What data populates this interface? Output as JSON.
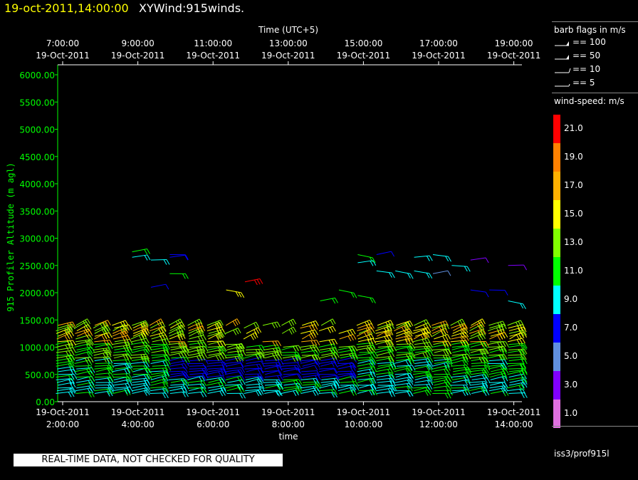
{
  "header": {
    "datetime": "19-oct-2011,14:00:00",
    "product": "XYWind:915winds."
  },
  "footer": {
    "quality_notice": "REAL-TIME DATA, NOT CHECKED FOR QUALITY"
  },
  "legend": {
    "barb_title": "barb flags in m/s",
    "barbs": [
      {
        "value": "== 100",
        "kind": "flag"
      },
      {
        "value": "== 50",
        "kind": "flag"
      },
      {
        "value": "== 10",
        "kind": "full"
      },
      {
        "value": "== 5",
        "kind": "half"
      }
    ],
    "speed_title": "wind-speed: m/s",
    "speed_bins": [
      {
        "label": "21.0",
        "color": "#ff0000"
      },
      {
        "label": "19.0",
        "color": "#ff8000"
      },
      {
        "label": "17.0",
        "color": "#ffb000"
      },
      {
        "label": "15.0",
        "color": "#ffff00"
      },
      {
        "label": "13.0",
        "color": "#80ff00"
      },
      {
        "label": "11.0",
        "color": "#00ff00"
      },
      {
        "label": "9.0",
        "color": "#00ffff"
      },
      {
        "label": "7.0",
        "color": "#0000ff"
      },
      {
        "label": "5.0",
        "color": "#6090e0"
      },
      {
        "label": "3.0",
        "color": "#8000ff"
      },
      {
        "label": "1.0",
        "color": "#e070e0"
      }
    ],
    "station": "iss3/prof915l"
  },
  "chart_data": {
    "type": "scatter",
    "subtype": "wind-barb time-height profile",
    "xlabel": "time",
    "x2label": "Time (UTC+5)",
    "ylabel": "915 Profiler Altitude (m agl)",
    "x_range_hours": [
      1.5,
      14.1
    ],
    "ylim": [
      0,
      6200
    ],
    "yticks": [
      "0.00",
      "500.00",
      "1000.00",
      "1500.00",
      "2000.00",
      "2500.00",
      "3000.00",
      "3500.00",
      "4000.00",
      "4500.00",
      "5000.00",
      "5500.00",
      "6000.00"
    ],
    "ytick_values": [
      0,
      500,
      1000,
      1500,
      2000,
      2500,
      3000,
      3500,
      4000,
      4500,
      5000,
      5500,
      6000
    ],
    "xticks_bottom": [
      {
        "hour": 2,
        "date": "19-Oct-2011",
        "time": "2:00:00"
      },
      {
        "hour": 4,
        "date": "19-Oct-2011",
        "time": "4:00:00"
      },
      {
        "hour": 6,
        "date": "19-Oct-2011",
        "time": "6:00:00"
      },
      {
        "hour": 8,
        "date": "19-Oct-2011",
        "time": "8:00:00"
      },
      {
        "hour": 10,
        "date": "19-Oct-2011",
        "time": "10:00:00"
      },
      {
        "hour": 12,
        "date": "19-Oct-2011",
        "time": "12:00:00"
      },
      {
        "hour": 14,
        "date": "19-Oct-2011",
        "time": "14:00:00"
      }
    ],
    "xticks_top": [
      {
        "hour": 2,
        "time": "7:00:00",
        "date": "19-Oct-2011"
      },
      {
        "hour": 4,
        "time": "9:00:00",
        "date": "19-Oct-2011"
      },
      {
        "hour": 6,
        "time": "11:00:00",
        "date": "19-Oct-2011"
      },
      {
        "hour": 8,
        "time": "13:00:00",
        "date": "19-Oct-2011"
      },
      {
        "hour": 10,
        "time": "15:00:00",
        "date": "19-Oct-2011"
      },
      {
        "hour": 12,
        "time": "17:00:00",
        "date": "19-Oct-2011"
      },
      {
        "hour": 14,
        "time": "19:00:00",
        "date": "19-Oct-2011"
      }
    ],
    "profile_hours": [
      2.0,
      2.5,
      3.0,
      3.5,
      4.0,
      4.5,
      5.0,
      5.5,
      6.0,
      6.5,
      7.0,
      7.5,
      8.0,
      8.5,
      9.0,
      9.5,
      10.0,
      10.5,
      11.0,
      11.5,
      12.0,
      12.5,
      13.0,
      13.5,
      14.0
    ],
    "low_gate_altitudes_m": [
      150,
      200,
      250,
      300,
      350,
      400,
      450,
      500,
      550,
      600,
      650,
      700,
      750,
      800,
      850,
      900,
      950,
      1000,
      1050,
      1100,
      1150,
      1200,
      1250,
      1300,
      1350,
      1400
    ],
    "upper_obs": [
      {
        "hour": 4.0,
        "alt": 2750,
        "spd": 11
      },
      {
        "hour": 4.0,
        "alt": 2650,
        "spd": 9
      },
      {
        "hour": 4.5,
        "alt": 2600,
        "spd": 9
      },
      {
        "hour": 5.0,
        "alt": 2700,
        "spd": 7
      },
      {
        "hour": 5.0,
        "alt": 2650,
        "spd": 7
      },
      {
        "hour": 5.0,
        "alt": 2350,
        "spd": 11
      },
      {
        "hour": 4.5,
        "alt": 2100,
        "spd": 7
      },
      {
        "hour": 7.0,
        "alt": 2200,
        "spd": 21
      },
      {
        "hour": 6.5,
        "alt": 2050,
        "spd": 15
      },
      {
        "hour": 10.0,
        "alt": 2700,
        "spd": 11
      },
      {
        "hour": 10.0,
        "alt": 2550,
        "spd": 9
      },
      {
        "hour": 10.5,
        "alt": 2700,
        "spd": 7
      },
      {
        "hour": 10.5,
        "alt": 2400,
        "spd": 9
      },
      {
        "hour": 11.0,
        "alt": 2400,
        "spd": 9
      },
      {
        "hour": 11.5,
        "alt": 2650,
        "spd": 9
      },
      {
        "hour": 11.5,
        "alt": 2400,
        "spd": 9
      },
      {
        "hour": 12.0,
        "alt": 2700,
        "spd": 9
      },
      {
        "hour": 12.0,
        "alt": 2350,
        "spd": 5
      },
      {
        "hour": 12.5,
        "alt": 2500,
        "spd": 9
      },
      {
        "hour": 13.0,
        "alt": 2600,
        "spd": 3
      },
      {
        "hour": 13.0,
        "alt": 2050,
        "spd": 7
      },
      {
        "hour": 13.5,
        "alt": 2050,
        "spd": 7
      },
      {
        "hour": 14.0,
        "alt": 2500,
        "spd": 3
      },
      {
        "hour": 14.0,
        "alt": 1850,
        "spd": 9
      },
      {
        "hour": 9.5,
        "alt": 2050,
        "spd": 11
      },
      {
        "hour": 9.0,
        "alt": 1850,
        "spd": 11
      },
      {
        "hour": 10.0,
        "alt": 1950,
        "spd": 11
      }
    ]
  }
}
